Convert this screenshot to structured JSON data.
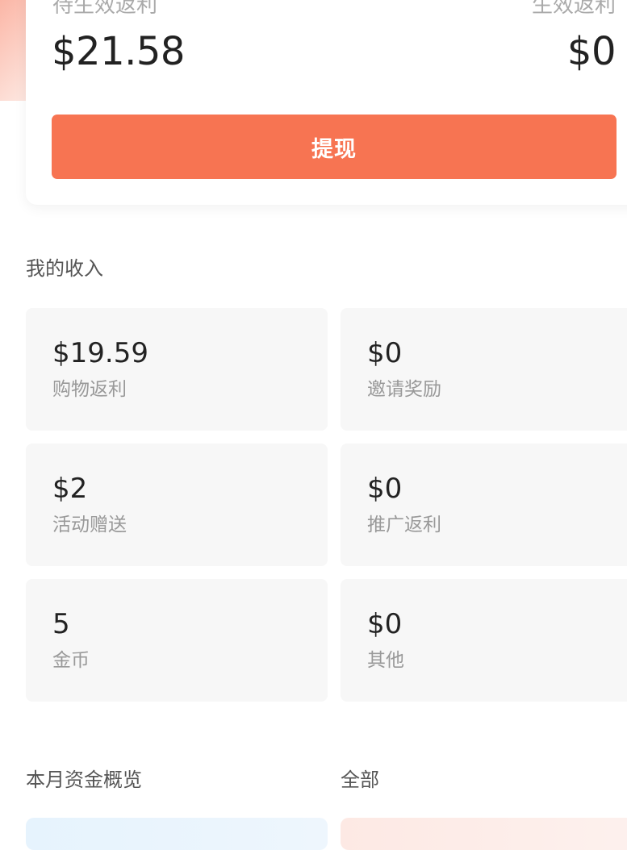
{
  "balance": {
    "pending_label": "待生效返利",
    "pending_value": "$21.58",
    "effective_label": "生效返利",
    "effective_value": "$0",
    "withdraw_label": "提现"
  },
  "income": {
    "title": "我的收入",
    "items": [
      {
        "value": "$19.59",
        "label": "购物返利"
      },
      {
        "value": "$0",
        "label": "邀请奖励"
      },
      {
        "value": "$2",
        "label": "活动赠送"
      },
      {
        "value": "$0",
        "label": "推广返利"
      },
      {
        "value": "5",
        "label": "金币"
      },
      {
        "value": "$0",
        "label": "其他"
      }
    ]
  },
  "overview": {
    "title": "本月资金概览",
    "filter_label": "全部"
  },
  "colors": {
    "accent": "#f77452",
    "card_bg": "#f7f7f7",
    "overview_blue": "#e6f3fd",
    "overview_red": "#fde9e4"
  }
}
